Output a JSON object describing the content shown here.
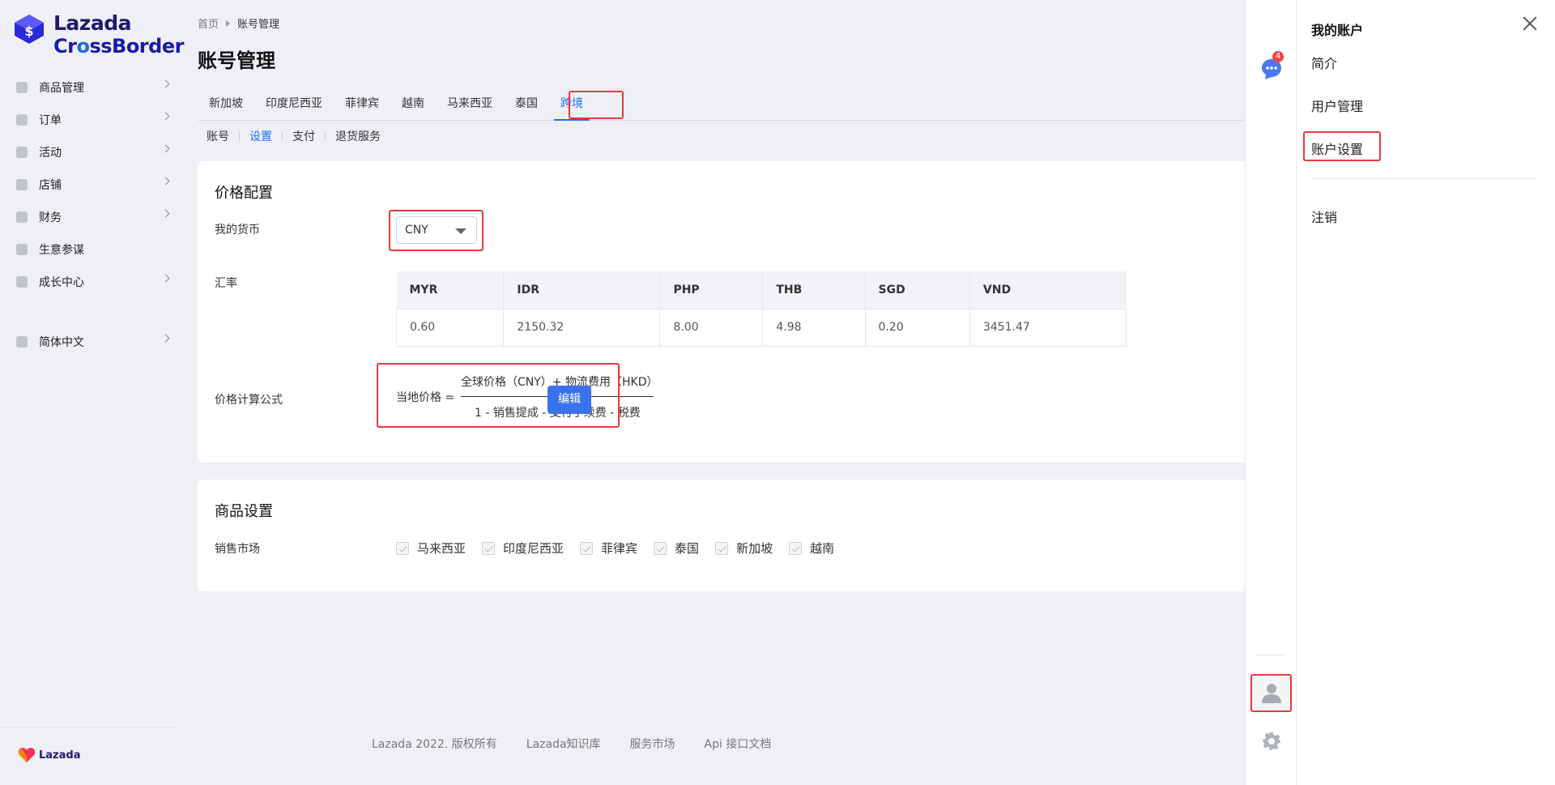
{
  "brand": {
    "name": "Lazada",
    "sub_prefix": "Cr",
    "sub_accent": "o",
    "sub_suffix": "ssBorder",
    "bottom_name": "Lazada"
  },
  "sidebar": {
    "items": [
      {
        "label": "商品管理",
        "icon": "box-icon",
        "has_arrow": true
      },
      {
        "label": "订单",
        "icon": "order-icon",
        "has_arrow": true
      },
      {
        "label": "活动",
        "icon": "activity-icon",
        "has_arrow": true
      },
      {
        "label": "店铺",
        "icon": "store-icon",
        "has_arrow": true
      },
      {
        "label": "财务",
        "icon": "finance-icon",
        "has_arrow": true
      },
      {
        "label": "生意参谋",
        "icon": "insights-icon",
        "has_arrow": false
      },
      {
        "label": "成长中心",
        "icon": "growth-icon",
        "has_arrow": true
      }
    ],
    "language": "简体中文"
  },
  "breadcrumb": {
    "home": "首页",
    "current": "账号管理"
  },
  "page_title": "账号管理",
  "country_tabs": [
    "新加坡",
    "印度尼西亚",
    "菲律宾",
    "越南",
    "马来西亚",
    "泰国",
    "跨境"
  ],
  "active_country_tab": "跨境",
  "sub_tabs": [
    "账号",
    "设置",
    "支付",
    "退货服务"
  ],
  "active_sub_tab": "设置",
  "price_config": {
    "title": "价格配置",
    "currency_label": "我的货币",
    "currency_value": "CNY",
    "rate_label": "汇率",
    "rate_headers": [
      "MYR",
      "IDR",
      "PHP",
      "THB",
      "SGD",
      "VND"
    ],
    "rate_values": [
      "0.60",
      "2150.32",
      "8.00",
      "4.98",
      "0.20",
      "3451.47"
    ],
    "formula_label": "价格计算公式",
    "formula_lhs": "当地价格 =",
    "formula_numerator": "全球价格（CNY）+ 物流费用（HKD）",
    "formula_denominator": "1 - 销售提成 - 支付手续费 - 税费",
    "edit_label": "编辑"
  },
  "product_settings": {
    "title": "商品设置",
    "market_label": "销售市场",
    "markets": [
      "马来西亚",
      "印度尼西亚",
      "菲律宾",
      "泰国",
      "新加坡",
      "越南"
    ]
  },
  "footer": {
    "copyright": "Lazada 2022. 版权所有",
    "links": [
      "Lazada知识库",
      "服务市场",
      "Api 接口文档"
    ]
  },
  "rail": {
    "chat_badge": "4"
  },
  "drawer": {
    "title": "我的账户",
    "items": [
      "简介",
      "用户管理",
      "账户设置",
      "注销"
    ]
  },
  "colors": {
    "accent": "#1a71ff",
    "highlight": "#e8383d",
    "button": "#3a72ee",
    "badge": "#f04545"
  }
}
